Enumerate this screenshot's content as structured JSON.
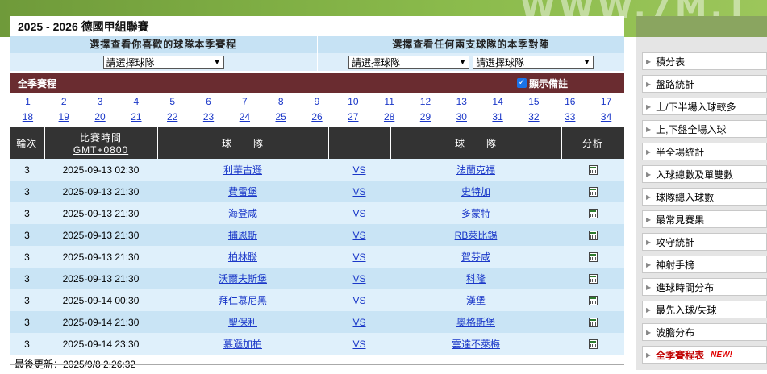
{
  "banner": {
    "watermark": "WWW.7M.T"
  },
  "title": "2025 - 2026 德國甲組聯賽",
  "selector": {
    "left_heading": "選擇查看你喜歡的球隊本季賽程",
    "right_heading": "選擇查看任何兩支球隊的本季對陣",
    "team_select_placeholder": "請選擇球隊",
    "team_a_placeholder": "請選擇球隊",
    "team_b_placeholder": "請選擇球隊"
  },
  "schedule_bar": {
    "label": "全季賽程",
    "show_notes": "顯示備註"
  },
  "rounds": [
    "1",
    "2",
    "3",
    "4",
    "5",
    "6",
    "7",
    "8",
    "9",
    "10",
    "11",
    "12",
    "13",
    "14",
    "15",
    "16",
    "17",
    "18",
    "19",
    "20",
    "21",
    "22",
    "23",
    "24",
    "25",
    "26",
    "27",
    "28",
    "29",
    "30",
    "31",
    "32",
    "33",
    "34"
  ],
  "table": {
    "headers": {
      "round": "輪次",
      "time": "比賽時間",
      "gmt": "GMT+0800",
      "home": "球　　隊",
      "vs": "",
      "away": "球　　隊",
      "analysis": "分析"
    },
    "rows": [
      {
        "round": "3",
        "time": "2025-09-13 02:30",
        "home": "利華古遜",
        "vs": "VS",
        "away": "法蘭克福"
      },
      {
        "round": "3",
        "time": "2025-09-13 21:30",
        "home": "費雷堡",
        "vs": "VS",
        "away": "史特加"
      },
      {
        "round": "3",
        "time": "2025-09-13 21:30",
        "home": "海登咸",
        "vs": "VS",
        "away": "多蒙特"
      },
      {
        "round": "3",
        "time": "2025-09-13 21:30",
        "home": "捕恩斯",
        "vs": "VS",
        "away": "RB萊比錫"
      },
      {
        "round": "3",
        "time": "2025-09-13 21:30",
        "home": "柏林聯",
        "vs": "VS",
        "away": "賀芬咸"
      },
      {
        "round": "3",
        "time": "2025-09-13 21:30",
        "home": "沃爾夫斯堡",
        "vs": "VS",
        "away": "科隆"
      },
      {
        "round": "3",
        "time": "2025-09-14 00:30",
        "home": "拜仁慕尼黑",
        "vs": "VS",
        "away": "漢堡"
      },
      {
        "round": "3",
        "time": "2025-09-14 21:30",
        "home": "聖保利",
        "vs": "VS",
        "away": "奧格斯堡"
      },
      {
        "round": "3",
        "time": "2025-09-14 23:30",
        "home": "慕遜加柏",
        "vs": "VS",
        "away": "雲達不萊梅"
      }
    ]
  },
  "last_updated": "最後更新：2025/9/8 2:26:32",
  "sidebar": {
    "items": [
      {
        "label": "積分表"
      },
      {
        "label": "盤路統計"
      },
      {
        "label": "上/下半場入球較多"
      },
      {
        "label": "上,下盤全場入球"
      },
      {
        "label": "半全場統計"
      },
      {
        "label": "入球總數及單雙數"
      },
      {
        "label": "球隊總入球數"
      },
      {
        "label": "最常見賽果"
      },
      {
        "label": "攻守統計"
      },
      {
        "label": "神射手榜"
      },
      {
        "label": "進球時間分布"
      },
      {
        "label": "最先入球/失球"
      },
      {
        "label": "波膽分布"
      },
      {
        "label": "全季賽程表",
        "badge": "NEW!"
      }
    ]
  },
  "colors": {
    "header_bar": "#6a2c30",
    "table_head": "#333333",
    "row_light": "#dff0fb",
    "row_dark": "#c9e4f5",
    "link": "#1a37c8"
  }
}
